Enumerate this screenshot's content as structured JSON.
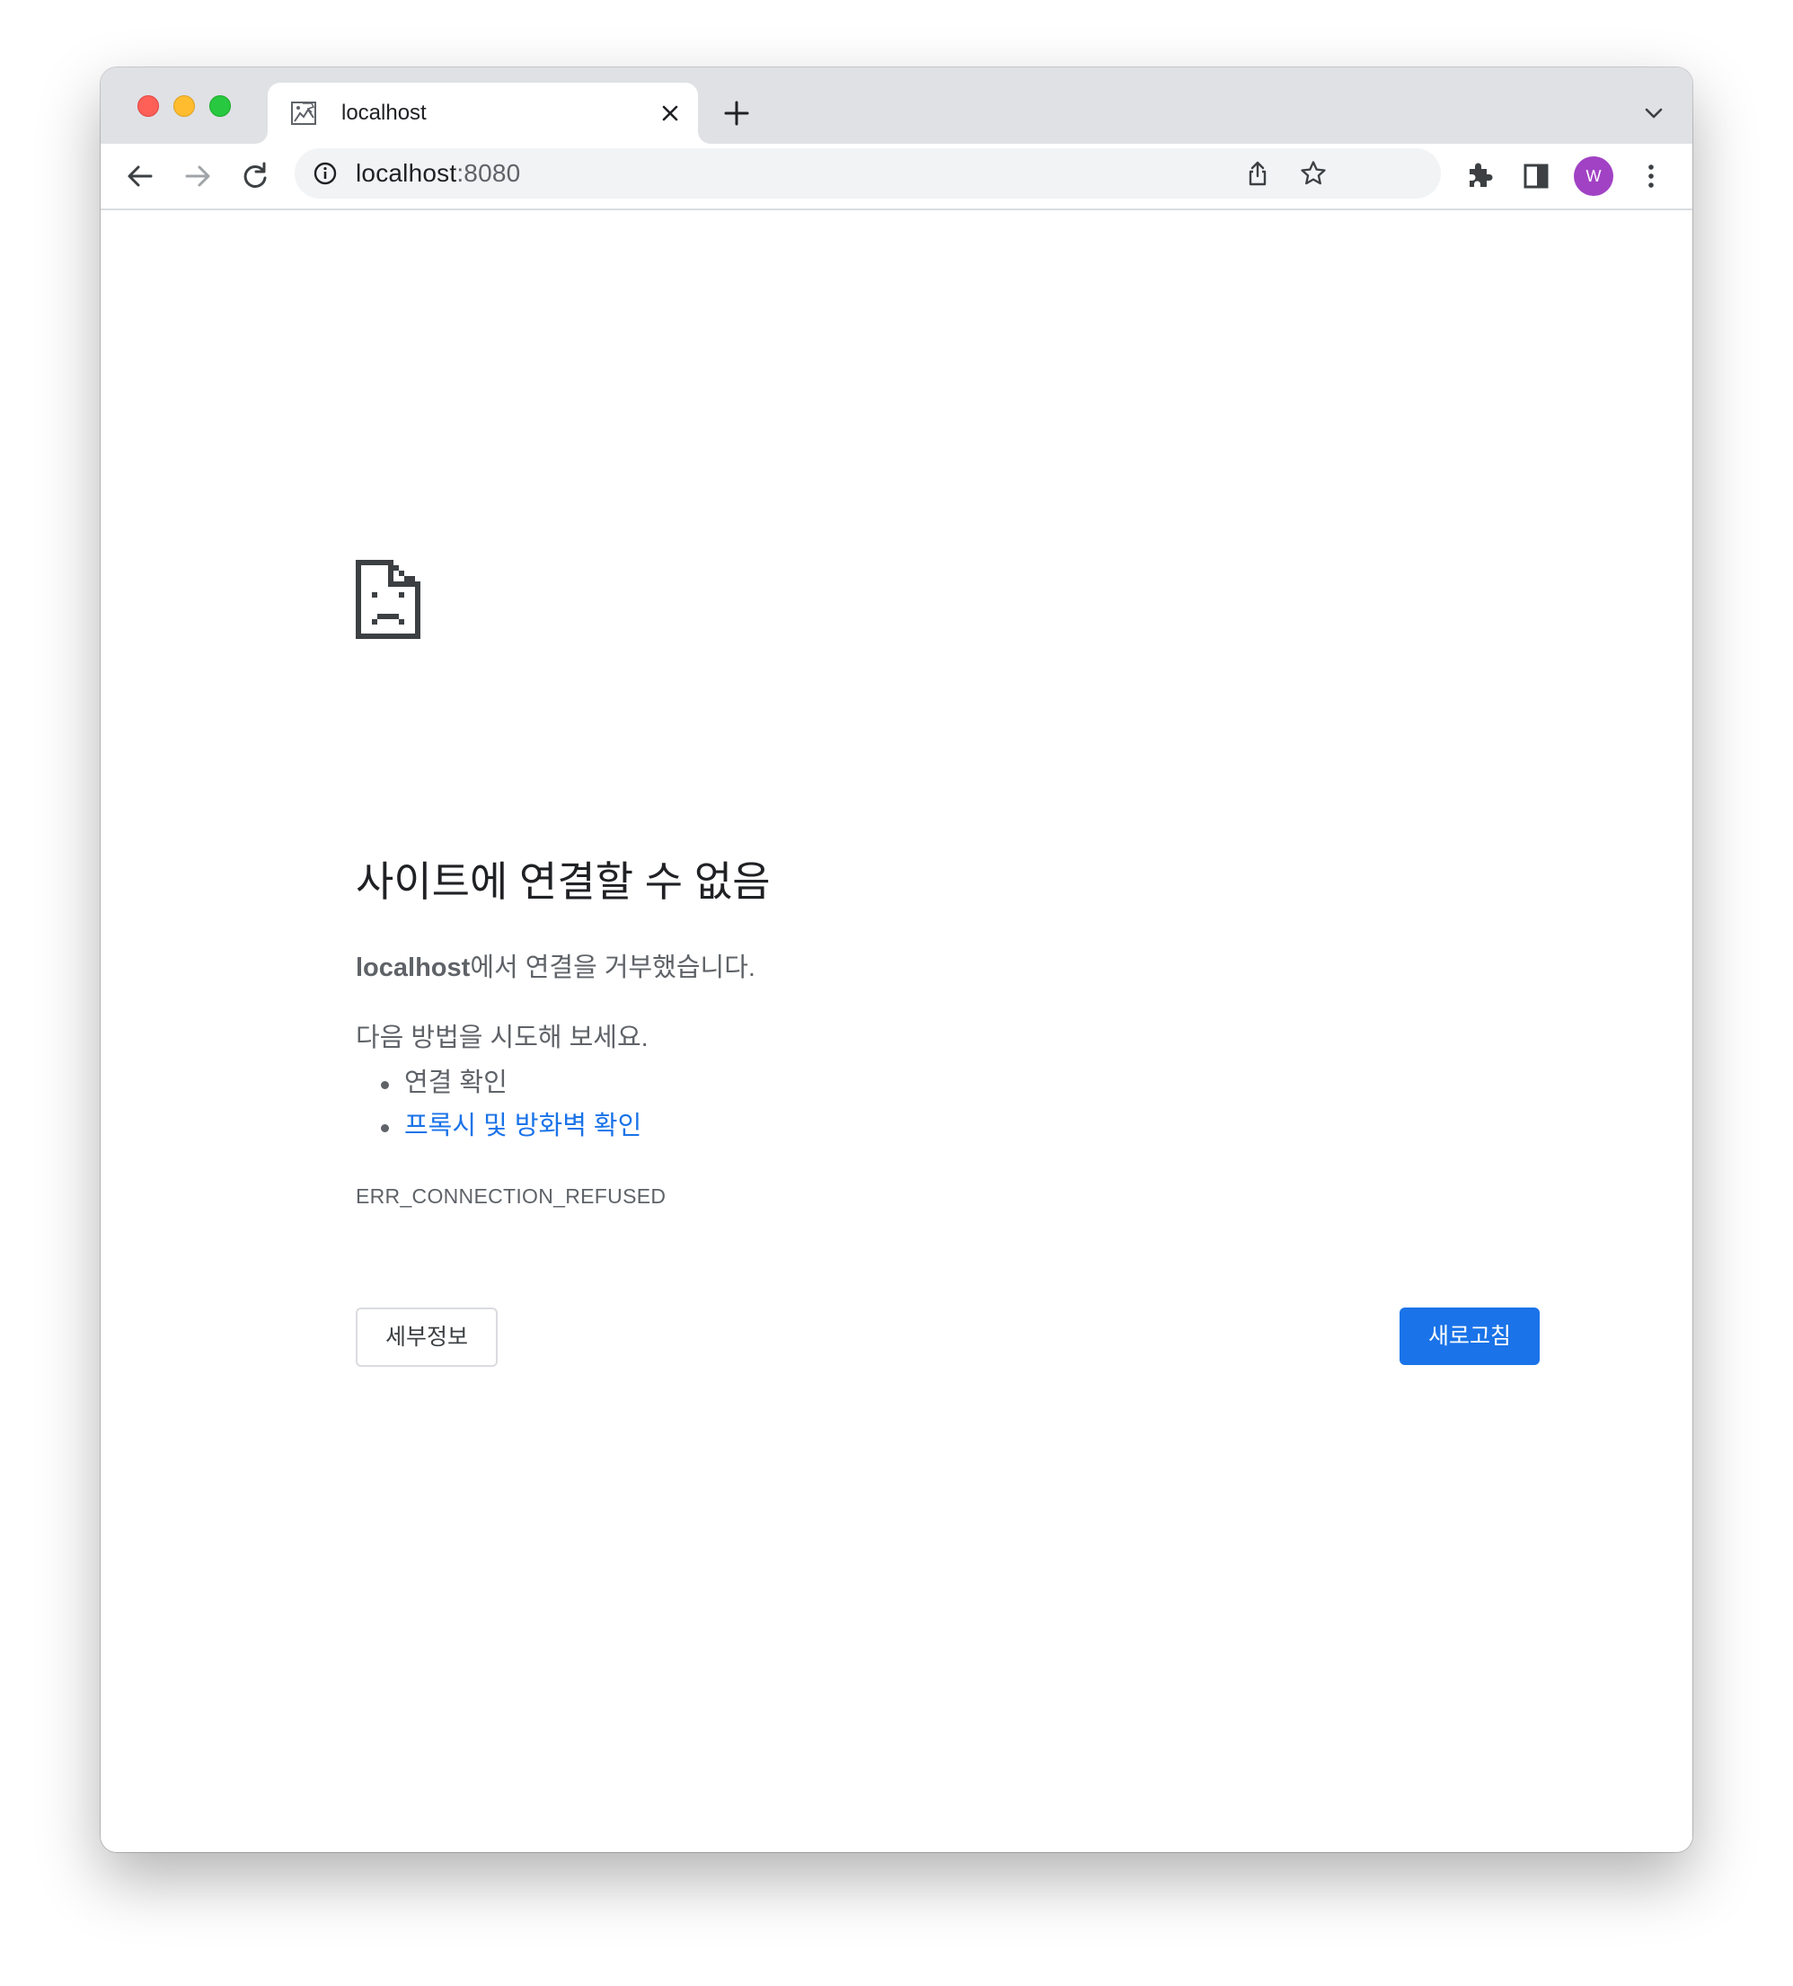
{
  "window": {
    "tab": {
      "title": "localhost",
      "favicon": "broken-page-favicon-icon"
    },
    "toolbar": {
      "url_host": "localhost",
      "url_port": ":8080",
      "profile_initial": "W",
      "profile_color": "#a142c4"
    }
  },
  "error_page": {
    "icon": "sad-page-icon",
    "title": "사이트에 연결할 수 없음",
    "host": "localhost",
    "summary_suffix": "에서 연결을 거부했습니다.",
    "suggestions_intro": "다음 방법을 시도해 보세요.",
    "suggestions": [
      {
        "label": "연결 확인",
        "is_link": false
      },
      {
        "label": "프록시 및 방화벽 확인",
        "is_link": true
      }
    ],
    "error_code": "ERR_CONNECTION_REFUSED",
    "details_button": "세부정보",
    "reload_button": "새로고침",
    "colors": {
      "accent": "#1a73e8",
      "text": "#5f6368",
      "heading": "#202124"
    }
  }
}
